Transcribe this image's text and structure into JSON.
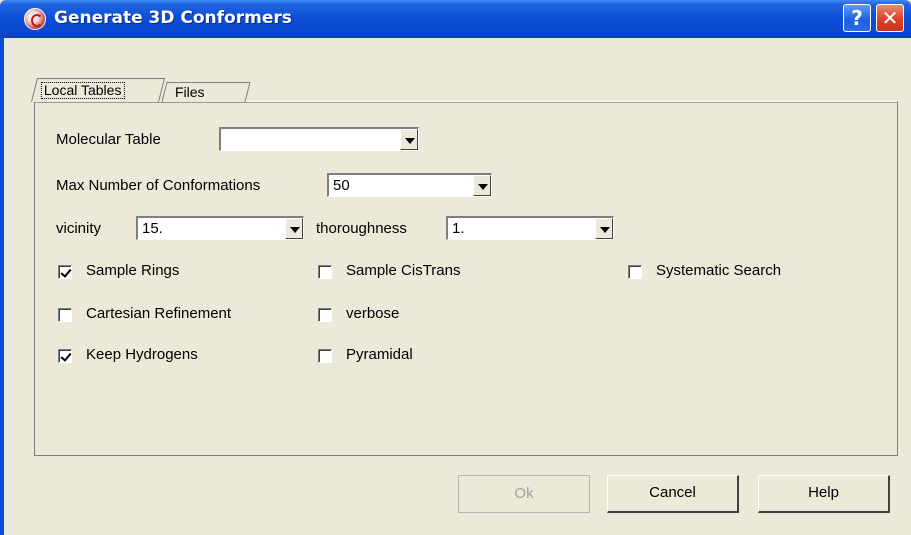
{
  "window": {
    "title": "Generate 3D Conformers",
    "help_glyph": "?",
    "close_glyph": "✕",
    "icon": "app-logo-icon"
  },
  "tabs": [
    {
      "label": "Local Tables",
      "active": true
    },
    {
      "label": "Files",
      "active": false
    }
  ],
  "form": {
    "molecular_table": {
      "label": "Molecular Table",
      "value": ""
    },
    "max_conformations": {
      "label": "Max Number of Conformations",
      "value": "50"
    },
    "vicinity": {
      "label": "vicinity",
      "value": "15."
    },
    "thoroughness": {
      "label": "thoroughness",
      "value": "1."
    }
  },
  "checkboxes": {
    "sample_rings": {
      "label": "Sample Rings",
      "checked": true
    },
    "sample_cistrans": {
      "label": "Sample CisTrans",
      "checked": false
    },
    "systematic_search": {
      "label": "Systematic Search",
      "checked": false
    },
    "cartesian_refinement": {
      "label": "Cartesian Refinement",
      "checked": false
    },
    "verbose": {
      "label": "verbose",
      "checked": false
    },
    "keep_hydrogens": {
      "label": "Keep Hydrogens",
      "checked": true
    },
    "pyramidal": {
      "label": "Pyramidal",
      "checked": false
    }
  },
  "buttons": {
    "ok": {
      "label": "Ok",
      "enabled": false
    },
    "cancel": {
      "label": "Cancel",
      "enabled": true
    },
    "help": {
      "label": "Help",
      "enabled": true
    }
  },
  "colors": {
    "titlebar": "#0b4dd6",
    "face": "#ece9d8",
    "close": "#d8432a"
  }
}
